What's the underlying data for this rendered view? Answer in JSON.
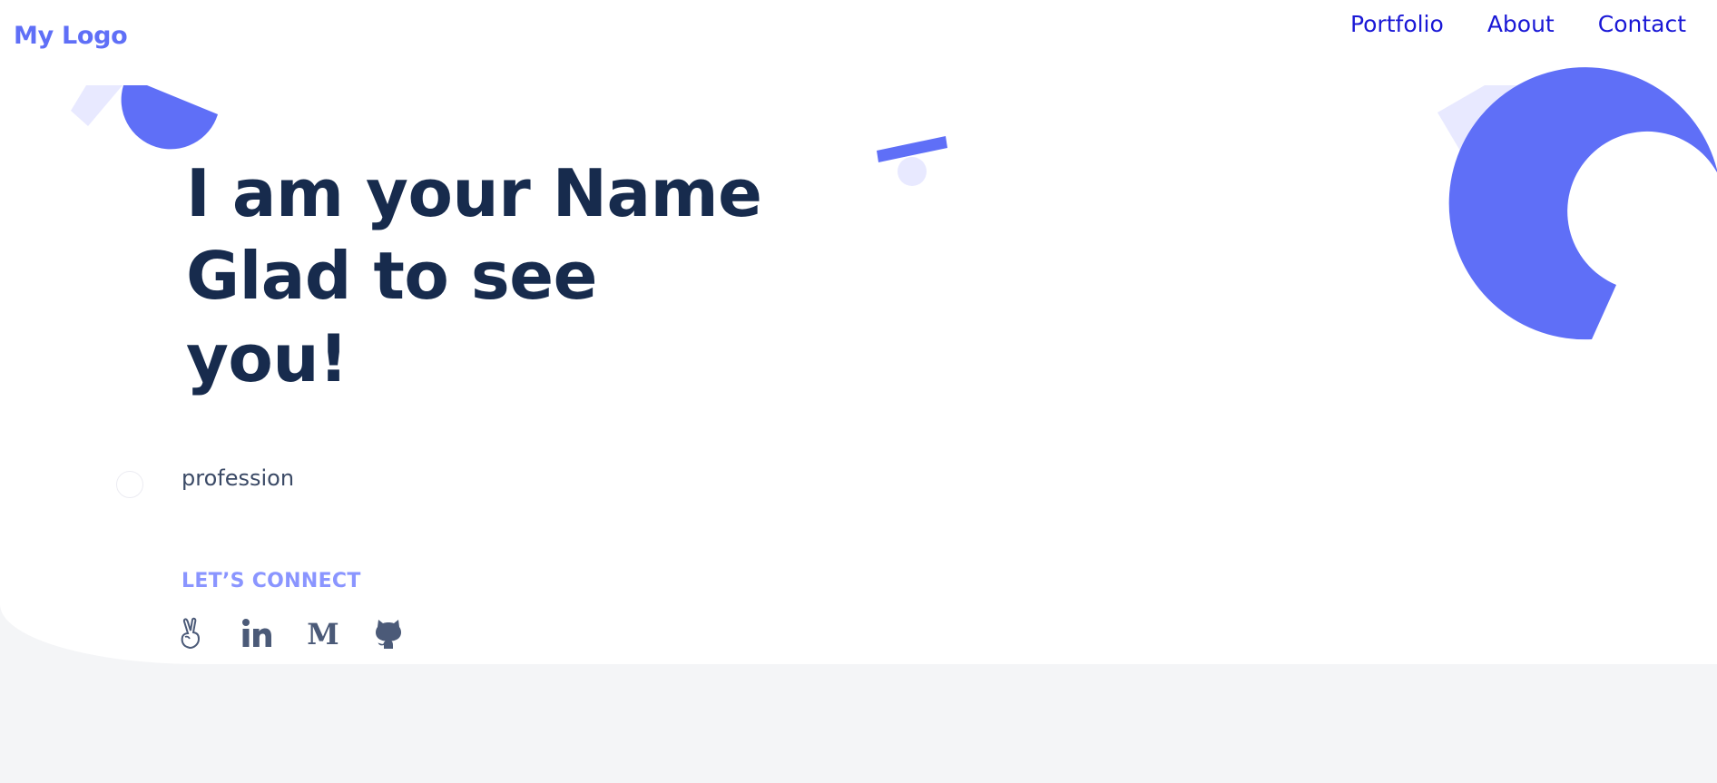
{
  "header": {
    "logo": "My Logo",
    "nav": [
      {
        "label": "Portfolio"
      },
      {
        "label": "About"
      },
      {
        "label": "Contact"
      }
    ]
  },
  "hero": {
    "headline_lines": [
      "I am your Name",
      "Glad to see",
      "you!"
    ],
    "profession": "profession",
    "connect_label": "LET’S CONNECT",
    "socials": [
      {
        "icon": "angellist-icon"
      },
      {
        "icon": "linkedin-icon"
      },
      {
        "icon": "medium-icon"
      },
      {
        "icon": "github-icon"
      }
    ]
  },
  "colors": {
    "brand": "#5f6ff7",
    "nav_link": "#1a18d6",
    "headline": "#172b4d",
    "connect": "#8a95ff",
    "light_shape": "#e8e9ff",
    "page_bg": "#f4f5f7"
  }
}
